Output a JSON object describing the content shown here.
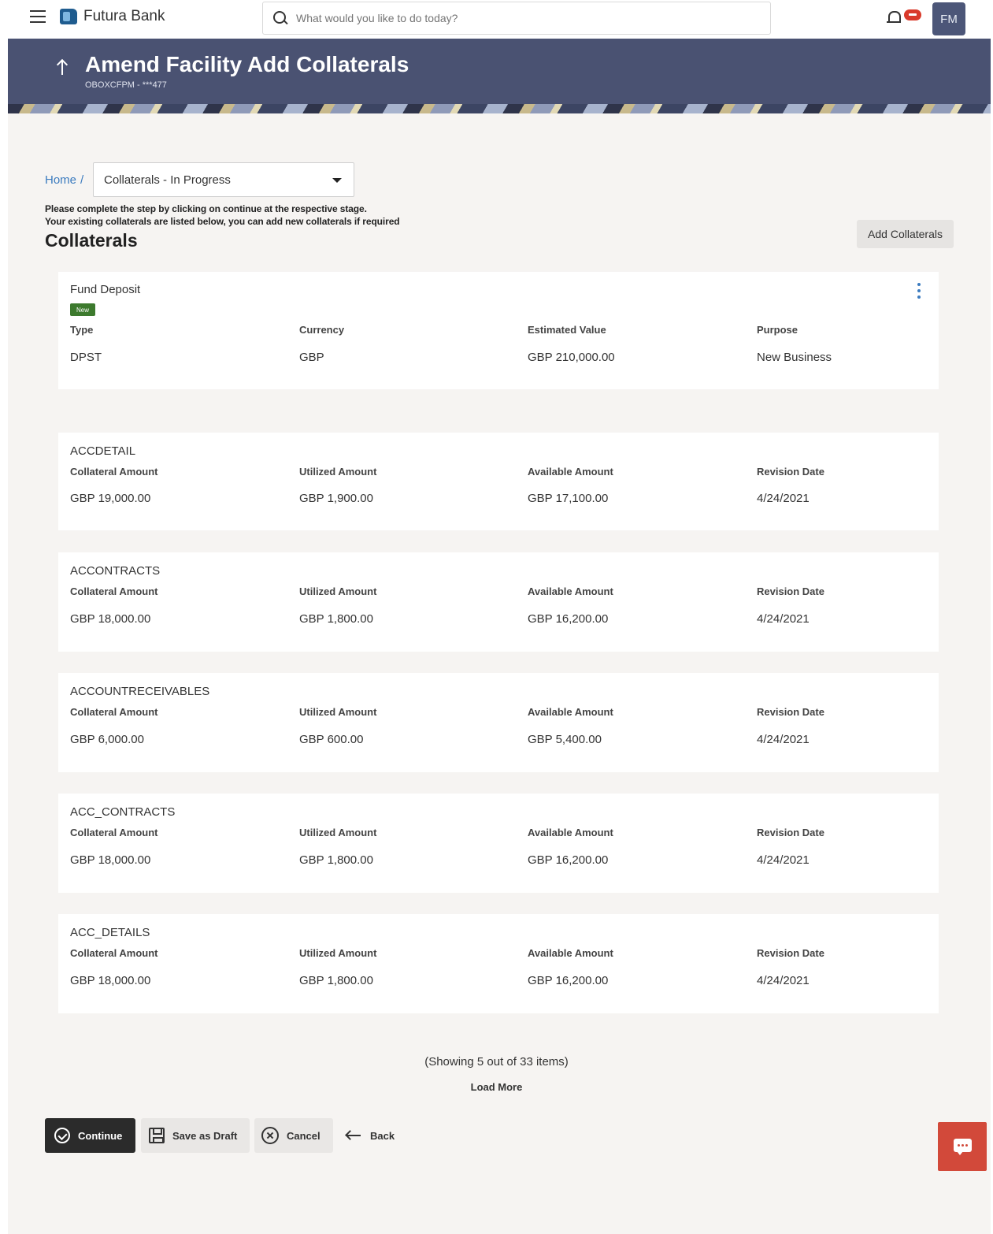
{
  "header": {
    "brand": "Futura Bank",
    "search_placeholder": "What would you like to do today?",
    "avatar_initials": "FM"
  },
  "banner": {
    "title": "Amend Facility Add Collaterals",
    "subtitle": "OBOXCFPM - ***477"
  },
  "breadcrumb": {
    "home": "Home",
    "separator": "/",
    "stage_selected": "Collaterals - In Progress"
  },
  "instructions": {
    "line1": "Please complete the step by clicking on continue at the respective stage.",
    "line2": "Your existing collaterals are listed below, you can add new collaterals if required"
  },
  "section": {
    "title": "Collaterals",
    "add_button": "Add Collaterals"
  },
  "new_collateral": {
    "name": "Fund Deposit",
    "badge": "New",
    "labels": [
      "Type",
      "Currency",
      "Estimated Value",
      "Purpose"
    ],
    "values": [
      "DPST",
      "GBP",
      "GBP 210,000.00",
      "New Business"
    ]
  },
  "collateral_labels": [
    "Collateral Amount",
    "Utilized Amount",
    "Available Amount",
    "Revision Date"
  ],
  "collaterals": [
    {
      "name": "ACCDETAIL",
      "values": [
        "GBP 19,000.00",
        "GBP 1,900.00",
        "GBP 17,100.00",
        "4/24/2021"
      ]
    },
    {
      "name": "ACCONTRACTS",
      "values": [
        "GBP 18,000.00",
        "GBP 1,800.00",
        "GBP 16,200.00",
        "4/24/2021"
      ]
    },
    {
      "name": "ACCOUNTRECEIVABLES",
      "values": [
        "GBP 6,000.00",
        "GBP 600.00",
        "GBP 5,400.00",
        "4/24/2021"
      ]
    },
    {
      "name": "ACC_CONTRACTS",
      "values": [
        "GBP 18,000.00",
        "GBP 1,800.00",
        "GBP 16,200.00",
        "4/24/2021"
      ]
    },
    {
      "name": "ACC_DETAILS",
      "values": [
        "GBP 18,000.00",
        "GBP 1,800.00",
        "GBP 16,200.00",
        "4/24/2021"
      ]
    }
  ],
  "pagination": {
    "showing": "(Showing 5 out of 33 items)",
    "load_more": "Load More"
  },
  "actions": {
    "continue": "Continue",
    "save_draft": "Save as Draft",
    "cancel": "Cancel",
    "back": "Back"
  }
}
